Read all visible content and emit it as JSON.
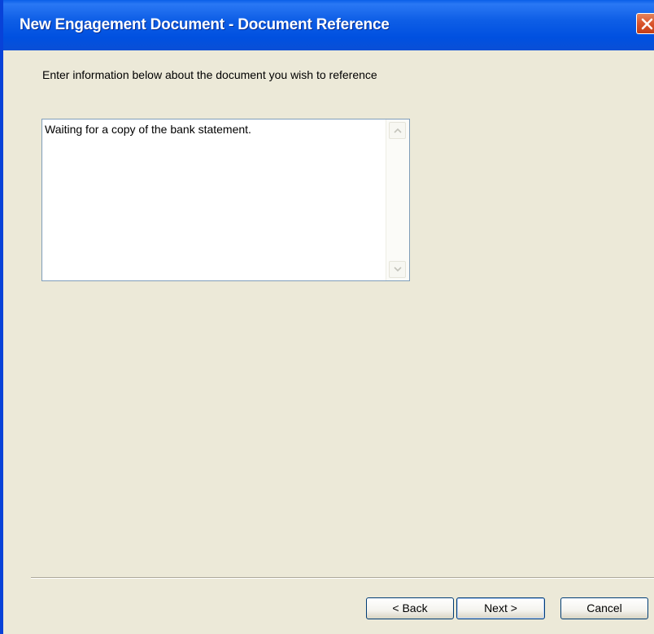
{
  "window": {
    "title": "New Engagement Document - Document Reference"
  },
  "content": {
    "instruction": "Enter information below about the document you wish to reference",
    "reference_text": "Waiting for a copy of the bank statement."
  },
  "buttons": {
    "back": "< Back",
    "next": "Next >",
    "cancel": "Cancel"
  },
  "colors": {
    "titlebar": "#0a5ee8",
    "dialog_background": "#ece9d8",
    "close_button": "#d9532b"
  },
  "icons": {
    "close": "close-icon",
    "scroll_up": "scroll-up-arrow-icon",
    "scroll_down": "scroll-down-arrow-icon"
  }
}
